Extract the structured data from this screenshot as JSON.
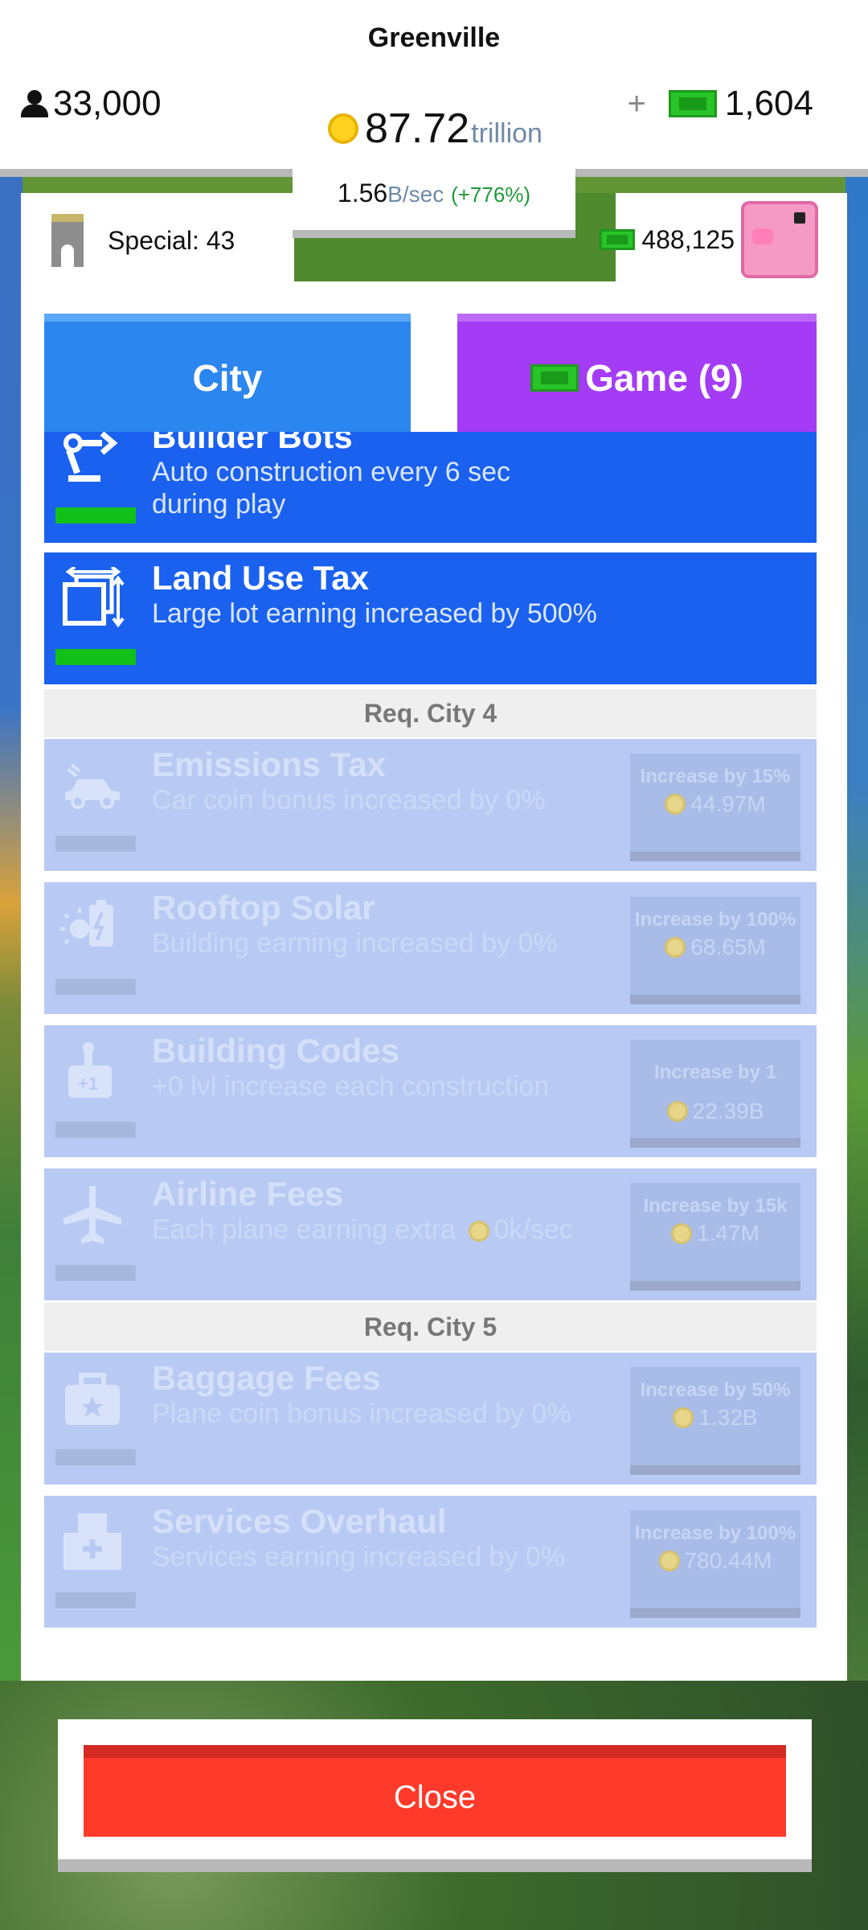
{
  "header": {
    "city_name": "Greenville",
    "population": "33,000",
    "cash_plus": "+",
    "cash": "1,604",
    "coins_value": "87.72",
    "coins_unit": "trillion",
    "rate_value": "1.56",
    "rate_unit": "B/sec",
    "rate_change": "(+776%)"
  },
  "panel": {
    "special_label": "Special: 43",
    "piggy_bank": "488,125"
  },
  "tabs": [
    {
      "label": "City"
    },
    {
      "label": "Game (9)"
    }
  ],
  "items": [
    {
      "title": "Builder Bots",
      "desc": "Auto construction every 6 sec during play",
      "icon": "robot-arm-icon"
    },
    {
      "title": "Land Use Tax",
      "desc": "Large lot earning increased by 500%",
      "icon": "resize-box-icon"
    }
  ],
  "sections": [
    {
      "requirement": "Req. City 4",
      "items": [
        {
          "title": "Emissions Tax",
          "desc": "Car coin bonus increased by 0%",
          "button": "Increase by 15%",
          "cost": "44.97M",
          "icon": "car-icon"
        },
        {
          "title": "Rooftop Solar",
          "desc": "Building earning increased by 0%",
          "button": "Increase by 100%",
          "cost": "68.65M",
          "icon": "solar-battery-icon"
        },
        {
          "title": "Building Codes",
          "desc": "+0 lvl increase each construction",
          "button": "Increase by 1",
          "cost": "22.39B",
          "icon": "building-plus-icon"
        },
        {
          "title": "Airline Fees",
          "desc_prefix": "Each plane earning extra",
          "desc_suffix": "0k/sec",
          "button": "Increase by 15k",
          "cost": "1.47M",
          "icon": "airplane-icon"
        }
      ]
    },
    {
      "requirement": "Req. City 5",
      "items": [
        {
          "title": "Baggage Fees",
          "desc": "Plane coin bonus increased by 0%",
          "button": "Increase by 50%",
          "cost": "1.32B",
          "icon": "suitcase-icon"
        },
        {
          "title": "Services Overhaul",
          "desc": "Services earning increased by 0%",
          "button": "Increase by 100%",
          "cost": "780.44M",
          "icon": "hospital-icon"
        }
      ]
    }
  ],
  "close_label": "Close",
  "colors": {
    "active_item": "#1a61f0",
    "locked_item": "#b8caf3",
    "city_tab": "#2c86f0",
    "game_tab": "#a43cf5",
    "close_button": "#ff3a2a"
  }
}
